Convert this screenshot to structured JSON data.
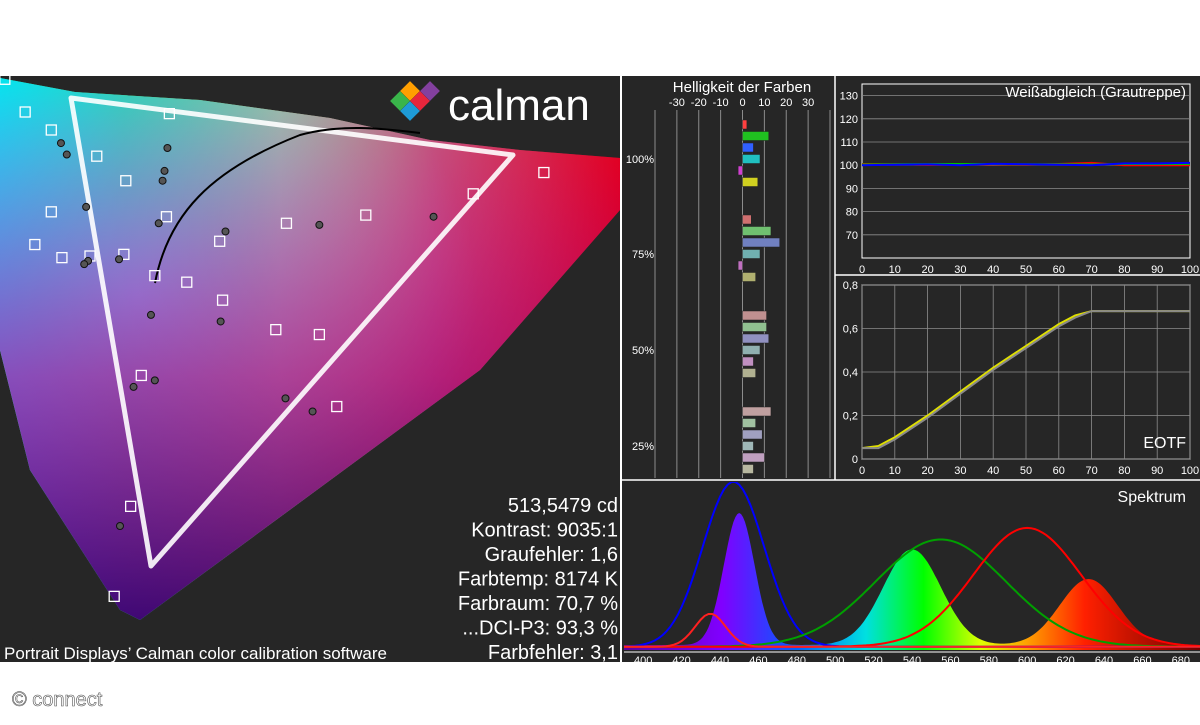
{
  "brand": {
    "logo_text": "calman",
    "caption": "Portrait Displays’ Calman color calibration software",
    "credit": "© connect"
  },
  "colors": {
    "panel_bg": "#262626",
    "grid": "#8c8c8c",
    "red": "#ff0000",
    "green": "#00c000",
    "blue": "#0000ff",
    "yellow": "#e0e000",
    "gamut_triangle": "#ffffff"
  },
  "stats": [
    "513,5479 cd",
    "Kontrast: 9035:1",
    "Graufehler: 1,6",
    "Farbtemp: 8174 K",
    "Farbraum: 70,7 %",
    "...DCI-P3: 93,3 %",
    "Farbfehler: 3,1"
  ],
  "chart_data": [
    {
      "type": "scatter",
      "name": "cie-chromaticity",
      "title": "",
      "gamut_triangle": [
        [
          0.0,
          0.0
        ],
        [
          0.0,
          0.0
        ],
        [
          0.0,
          0.0
        ]
      ],
      "targets_uv": [
        [
          0.005,
          0.598
        ],
        [
          0.026,
          0.578
        ],
        [
          0.053,
          0.567
        ],
        [
          0.175,
          0.577
        ],
        [
          0.1,
          0.551
        ],
        [
          0.053,
          0.517
        ],
        [
          0.13,
          0.536
        ],
        [
          0.172,
          0.514
        ],
        [
          0.036,
          0.497
        ],
        [
          0.227,
          0.499
        ],
        [
          0.296,
          0.51
        ],
        [
          0.378,
          0.515
        ],
        [
          0.489,
          0.528
        ],
        [
          0.562,
          0.541
        ],
        [
          0.064,
          0.489
        ],
        [
          0.093,
          0.49
        ],
        [
          0.128,
          0.491
        ],
        [
          0.16,
          0.478
        ],
        [
          0.193,
          0.474
        ],
        [
          0.23,
          0.463
        ],
        [
          0.285,
          0.445
        ],
        [
          0.33,
          0.442
        ],
        [
          0.348,
          0.398
        ],
        [
          0.146,
          0.417
        ],
        [
          0.135,
          0.337
        ],
        [
          0.118,
          0.282
        ]
      ],
      "measured_uv": [
        [
          0.063,
          0.559
        ],
        [
          0.069,
          0.552
        ],
        [
          0.173,
          0.556
        ],
        [
          0.17,
          0.542
        ],
        [
          0.168,
          0.536
        ],
        [
          0.089,
          0.52
        ],
        [
          0.164,
          0.51
        ],
        [
          0.233,
          0.505
        ],
        [
          0.33,
          0.509
        ],
        [
          0.448,
          0.514
        ],
        [
          0.091,
          0.487
        ],
        [
          0.087,
          0.485
        ],
        [
          0.123,
          0.488
        ],
        [
          0.156,
          0.454
        ],
        [
          0.228,
          0.45
        ],
        [
          0.295,
          0.403
        ],
        [
          0.138,
          0.41
        ],
        [
          0.16,
          0.414
        ],
        [
          0.323,
          0.395
        ],
        [
          0.124,
          0.325
        ]
      ]
    },
    {
      "type": "bar",
      "name": "helligkeit-der-farben",
      "title": "Helligkeit der Farben",
      "x_ticks": [
        "-30",
        "-20",
        "-10",
        "0",
        "10",
        "20",
        "30"
      ],
      "xlim": [
        -40,
        40
      ],
      "y_labels": [
        "100%",
        "75%",
        "50%",
        "25%"
      ],
      "groups": [
        {
          "level": "100%",
          "bars": [
            {
              "color": "#ff4040",
              "value": 2
            },
            {
              "color": "#20c020",
              "value": 12
            },
            {
              "color": "#3060ff",
              "value": 5
            },
            {
              "color": "#20c0c0",
              "value": 8
            },
            {
              "color": "#d040d0",
              "value": -2
            },
            {
              "color": "#d0d020",
              "value": 7
            }
          ]
        },
        {
          "level": "75%",
          "bars": [
            {
              "color": "#d07070",
              "value": 4
            },
            {
              "color": "#70c070",
              "value": 13
            },
            {
              "color": "#7080c0",
              "value": 17
            },
            {
              "color": "#70b0b0",
              "value": 8
            },
            {
              "color": "#c070c0",
              "value": -2
            },
            {
              "color": "#b0b070",
              "value": 6
            }
          ]
        },
        {
          "level": "50%",
          "bars": [
            {
              "color": "#c09090",
              "value": 11
            },
            {
              "color": "#90c090",
              "value": 11
            },
            {
              "color": "#9090c0",
              "value": 12
            },
            {
              "color": "#90b0b0",
              "value": 8
            },
            {
              "color": "#c090c0",
              "value": 5
            },
            {
              "color": "#b0b090",
              "value": 6
            }
          ]
        },
        {
          "level": "25%",
          "bars": [
            {
              "color": "#c0a0a0",
              "value": 13
            },
            {
              "color": "#a0c0a0",
              "value": 6
            },
            {
              "color": "#a0a0c0",
              "value": 9
            },
            {
              "color": "#a0b8b8",
              "value": 5
            },
            {
              "color": "#c0a0c0",
              "value": 10
            },
            {
              "color": "#b8b8a0",
              "value": 5
            }
          ]
        }
      ]
    },
    {
      "type": "line",
      "name": "weissabgleich",
      "title": "Weißabgleich (Grautreppe)",
      "x": [
        0,
        10,
        20,
        30,
        40,
        50,
        60,
        70,
        80,
        90,
        100
      ],
      "x_ticks": [
        "0",
        "10",
        "20",
        "30",
        "40",
        "50",
        "60",
        "70",
        "80",
        "90",
        "100"
      ],
      "y_ticks": [
        "70",
        "80",
        "90",
        "100",
        "110",
        "120",
        "130"
      ],
      "ylim": [
        60,
        135
      ],
      "series": [
        {
          "color": "#ff0000",
          "values": [
            100.5,
            100.4,
            100.2,
            100.3,
            100.4,
            100.2,
            100.5,
            101.0,
            100.0,
            100.0,
            100.0
          ]
        },
        {
          "color": "#00c000",
          "values": [
            100.3,
            100.4,
            100.5,
            100.5,
            100.5,
            100.4,
            100.4,
            100.3,
            100.5,
            100.5,
            100.5
          ]
        },
        {
          "color": "#0000ff",
          "values": [
            100.0,
            100.2,
            100.4,
            100.0,
            100.6,
            100.4,
            100.2,
            100.0,
            100.8,
            100.8,
            101.0
          ]
        }
      ]
    },
    {
      "type": "line",
      "name": "eotf",
      "title": "EOTF",
      "x": [
        0,
        5,
        10,
        20,
        30,
        40,
        50,
        60,
        65,
        70,
        80,
        90,
        100
      ],
      "x_ticks": [
        "0",
        "10",
        "20",
        "30",
        "40",
        "50",
        "60",
        "70",
        "80",
        "90",
        "100"
      ],
      "y_ticks": [
        "0",
        "0,2",
        "0,4",
        "0,6",
        "0,8"
      ],
      "ylim": [
        0,
        0.8
      ],
      "series": [
        {
          "color": "#e0e000",
          "values": [
            0.05,
            0.06,
            0.1,
            0.2,
            0.31,
            0.42,
            0.52,
            0.62,
            0.66,
            0.68,
            0.68,
            0.68,
            0.68
          ]
        },
        {
          "color": "#8a8a8a",
          "values": [
            0.05,
            0.05,
            0.09,
            0.19,
            0.3,
            0.41,
            0.51,
            0.61,
            0.65,
            0.68,
            0.68,
            0.68,
            0.68
          ]
        }
      ]
    },
    {
      "type": "line",
      "name": "spektrum",
      "title": "Spektrum",
      "x_ticks": [
        "400",
        "420",
        "440",
        "460",
        "480",
        "500",
        "520",
        "540",
        "560",
        "580",
        "600",
        "620",
        "640",
        "660",
        "680"
      ],
      "xlim": [
        390,
        690
      ],
      "ylim": [
        0,
        1
      ],
      "series": [
        {
          "color": "#0000ff",
          "peak": 447,
          "width": 16,
          "height": 1.0
        },
        {
          "color": "#00a000",
          "peak": 555,
          "width": 34,
          "height": 0.65
        },
        {
          "color": "#ff0000",
          "peak": 600,
          "width": 28,
          "height": 0.72
        },
        {
          "color": "#ff2020",
          "peak": 435,
          "width": 8,
          "height": 0.2
        }
      ],
      "measured": [
        {
          "peak": 450,
          "width": 8,
          "height": 0.8
        },
        {
          "peak": 540,
          "width": 15,
          "height": 0.58
        },
        {
          "peak": 632,
          "width": 15,
          "height": 0.4
        }
      ]
    }
  ]
}
